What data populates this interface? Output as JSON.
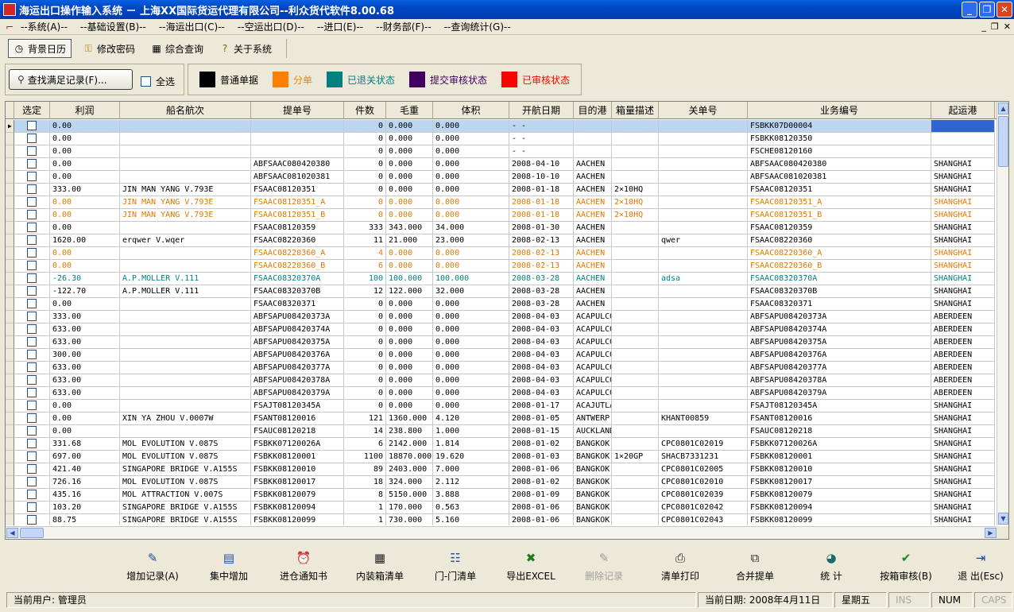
{
  "window": {
    "title": "海运出口操作输入系统 － 上海XX国际货运代理有限公司--利众货代软件8.00.68",
    "buttons": {
      "minimize": "_",
      "maximize": "❐",
      "close": "✕"
    }
  },
  "menu": {
    "items": [
      "--系统(A)--",
      "--基础设置(B)--",
      "--海运出口(C)--",
      "--空运出口(D)--",
      "--进口(E)--",
      "--财务部(F)--",
      "--查询统计(G)--"
    ],
    "mdi_buttons": [
      "_",
      "❐",
      "✕"
    ]
  },
  "toolbar": {
    "items": [
      {
        "label": "背景日历",
        "icon": "clock-icon"
      },
      {
        "label": "修改密码",
        "icon": "key-icon"
      },
      {
        "label": "综合查询",
        "icon": "grid-icon"
      },
      {
        "label": "关于系统",
        "icon": "help-icon"
      }
    ]
  },
  "filter": {
    "find_label": "查找满足记录(F)...",
    "select_all_label": "全选"
  },
  "legend": [
    {
      "label": "普通单据",
      "color": "#000000"
    },
    {
      "label": "分单",
      "color": "#ff8000"
    },
    {
      "label": "已退关状态",
      "color": "#008080"
    },
    {
      "label": "提交审核状态",
      "color": "#400060"
    },
    {
      "label": "已审核状态",
      "color": "#ff0000"
    }
  ],
  "grid": {
    "columns": [
      "选定",
      "利润",
      "船名航次",
      "提单号",
      "件数",
      "毛重",
      "体积",
      "开航日期",
      "目的港",
      "箱量描述",
      "关单号",
      "业务编号",
      "起运港"
    ],
    "colors": {
      "normal": "#000000",
      "split": "#e07800",
      "closed": "#008080"
    },
    "rows": [
      {
        "profit": "0.00",
        "vessel": "",
        "bl": "",
        "pcs": "0",
        "gw": "0.000",
        "vol": "0.000",
        "date": "-  -",
        "dest": "",
        "box": "",
        "customs": "",
        "biz": "FSBKK07D00004",
        "pol": "",
        "style": "normal",
        "selected": true
      },
      {
        "profit": "0.00",
        "vessel": "",
        "bl": "",
        "pcs": "0",
        "gw": "0.000",
        "vol": "0.000",
        "date": "-  -",
        "dest": "",
        "box": "",
        "customs": "",
        "biz": "FSBKK08120350",
        "pol": "",
        "style": "normal"
      },
      {
        "profit": "0.00",
        "vessel": "",
        "bl": "",
        "pcs": "0",
        "gw": "0.000",
        "vol": "0.000",
        "date": "-  -",
        "dest": "",
        "box": "",
        "customs": "",
        "biz": "FSCHE08120160",
        "pol": "",
        "style": "normal"
      },
      {
        "profit": "0.00",
        "vessel": "",
        "bl": "ABFSAAC080420380",
        "pcs": "0",
        "gw": "0.000",
        "vol": "0.000",
        "date": "2008-04-10",
        "dest": "AACHEN",
        "box": "",
        "customs": "",
        "biz": "ABFSAAC080420380",
        "pol": "SHANGHAI",
        "style": "normal"
      },
      {
        "profit": "0.00",
        "vessel": "",
        "bl": "ABFSAAC081020381",
        "pcs": "0",
        "gw": "0.000",
        "vol": "0.000",
        "date": "2008-10-10",
        "dest": "AACHEN",
        "box": "",
        "customs": "",
        "biz": "ABFSAAC081020381",
        "pol": "SHANGHAI",
        "style": "normal"
      },
      {
        "profit": "333.00",
        "vessel": "JIN MAN YANG V.793E",
        "bl": "FSAAC08120351",
        "pcs": "0",
        "gw": "0.000",
        "vol": "0.000",
        "date": "2008-01-18",
        "dest": "AACHEN",
        "box": "2×10HQ",
        "customs": "",
        "biz": "FSAAC08120351",
        "pol": "SHANGHAI",
        "style": "normal"
      },
      {
        "profit": "0.00",
        "vessel": "JIN MAN YANG V.793E",
        "bl": "FSAAC08120351_A",
        "pcs": "0",
        "gw": "0.000",
        "vol": "0.000",
        "date": "2008-01-18",
        "dest": "AACHEN",
        "box": "2×10HQ",
        "customs": "",
        "biz": "FSAAC08120351_A",
        "pol": "SHANGHAI",
        "style": "split"
      },
      {
        "profit": "0.00",
        "vessel": "JIN MAN YANG V.793E",
        "bl": "FSAAC08120351_B",
        "pcs": "0",
        "gw": "0.000",
        "vol": "0.000",
        "date": "2008-01-18",
        "dest": "AACHEN",
        "box": "2×10HQ",
        "customs": "",
        "biz": "FSAAC08120351_B",
        "pol": "SHANGHAI",
        "style": "split"
      },
      {
        "profit": "0.00",
        "vessel": "",
        "bl": "FSAAC08120359",
        "pcs": "333",
        "gw": "343.000",
        "vol": "34.000",
        "date": "2008-01-30",
        "dest": "AACHEN",
        "box": "",
        "customs": "",
        "biz": "FSAAC08120359",
        "pol": "SHANGHAI",
        "style": "normal"
      },
      {
        "profit": "1620.00",
        "vessel": "erqwer V.wqer",
        "bl": "FSAAC08220360",
        "pcs": "11",
        "gw": "21.000",
        "vol": "23.000",
        "date": "2008-02-13",
        "dest": "AACHEN",
        "box": "",
        "customs": "qwer",
        "biz": "FSAAC08220360",
        "pol": "SHANGHAI",
        "style": "normal"
      },
      {
        "profit": "0.00",
        "vessel": "",
        "bl": "FSAAC08220360_A",
        "pcs": "4",
        "gw": "0.000",
        "vol": "0.000",
        "date": "2008-02-13",
        "dest": "AACHEN",
        "box": "",
        "customs": "",
        "biz": "FSAAC08220360_A",
        "pol": "SHANGHAI",
        "style": "split"
      },
      {
        "profit": "0.00",
        "vessel": "",
        "bl": "FSAAC08220360_B",
        "pcs": "6",
        "gw": "0.000",
        "vol": "0.000",
        "date": "2008-02-13",
        "dest": "AACHEN",
        "box": "",
        "customs": "",
        "biz": "FSAAC08220360_B",
        "pol": "SHANGHAI",
        "style": "split"
      },
      {
        "profit": "-26.30",
        "vessel": "A.P.MOLLER V.111",
        "bl": "FSAAC08320370A",
        "pcs": "100",
        "gw": "100.000",
        "vol": "100.000",
        "date": "2008-03-28",
        "dest": "AACHEN",
        "box": "",
        "customs": "adsa",
        "biz": "FSAAC08320370A",
        "pol": "SHANGHAI",
        "style": "closed"
      },
      {
        "profit": "-122.70",
        "vessel": "A.P.MOLLER V.111",
        "bl": "FSAAC08320370B",
        "pcs": "12",
        "gw": "122.000",
        "vol": "32.000",
        "date": "2008-03-28",
        "dest": "AACHEN",
        "box": "",
        "customs": "",
        "biz": "FSAAC08320370B",
        "pol": "SHANGHAI",
        "style": "normal"
      },
      {
        "profit": "0.00",
        "vessel": "",
        "bl": "FSAAC08320371",
        "pcs": "0",
        "gw": "0.000",
        "vol": "0.000",
        "date": "2008-03-28",
        "dest": "AACHEN",
        "box": "",
        "customs": "",
        "biz": "FSAAC08320371",
        "pol": "SHANGHAI",
        "style": "normal"
      },
      {
        "profit": "333.00",
        "vessel": "",
        "bl": "ABFSAPU08420373A",
        "pcs": "0",
        "gw": "0.000",
        "vol": "0.000",
        "date": "2008-04-03",
        "dest": "ACAPULCO",
        "box": "",
        "customs": "",
        "biz": "ABFSAPU08420373A",
        "pol": "ABERDEEN",
        "style": "normal"
      },
      {
        "profit": "633.00",
        "vessel": "",
        "bl": "ABFSAPU08420374A",
        "pcs": "0",
        "gw": "0.000",
        "vol": "0.000",
        "date": "2008-04-03",
        "dest": "ACAPULCO",
        "box": "",
        "customs": "",
        "biz": "ABFSAPU08420374A",
        "pol": "ABERDEEN",
        "style": "normal"
      },
      {
        "profit": "633.00",
        "vessel": "",
        "bl": "ABFSAPU08420375A",
        "pcs": "0",
        "gw": "0.000",
        "vol": "0.000",
        "date": "2008-04-03",
        "dest": "ACAPULCO",
        "box": "",
        "customs": "",
        "biz": "ABFSAPU08420375A",
        "pol": "ABERDEEN",
        "style": "normal"
      },
      {
        "profit": "300.00",
        "vessel": "",
        "bl": "ABFSAPU08420376A",
        "pcs": "0",
        "gw": "0.000",
        "vol": "0.000",
        "date": "2008-04-03",
        "dest": "ACAPULCO",
        "box": "",
        "customs": "",
        "biz": "ABFSAPU08420376A",
        "pol": "ABERDEEN",
        "style": "normal"
      },
      {
        "profit": "633.00",
        "vessel": "",
        "bl": "ABFSAPU08420377A",
        "pcs": "0",
        "gw": "0.000",
        "vol": "0.000",
        "date": "2008-04-03",
        "dest": "ACAPULCO",
        "box": "",
        "customs": "",
        "biz": "ABFSAPU08420377A",
        "pol": "ABERDEEN",
        "style": "normal"
      },
      {
        "profit": "633.00",
        "vessel": "",
        "bl": "ABFSAPU08420378A",
        "pcs": "0",
        "gw": "0.000",
        "vol": "0.000",
        "date": "2008-04-03",
        "dest": "ACAPULCO",
        "box": "",
        "customs": "",
        "biz": "ABFSAPU08420378A",
        "pol": "ABERDEEN",
        "style": "normal"
      },
      {
        "profit": "633.00",
        "vessel": "",
        "bl": "ABFSAPU08420379A",
        "pcs": "0",
        "gw": "0.000",
        "vol": "0.000",
        "date": "2008-04-03",
        "dest": "ACAPULCO",
        "box": "",
        "customs": "",
        "biz": "ABFSAPU08420379A",
        "pol": "ABERDEEN",
        "style": "normal"
      },
      {
        "profit": "0.00",
        "vessel": "",
        "bl": "FSAJT08120345A",
        "pcs": "0",
        "gw": "0.000",
        "vol": "0.000",
        "date": "2008-01-17",
        "dest": "ACAJUTLA",
        "box": "",
        "customs": "",
        "biz": "FSAJT08120345A",
        "pol": "SHANGHAI",
        "style": "normal"
      },
      {
        "profit": "0.00",
        "vessel": "XIN YA ZHOU V.0007W",
        "bl": "FSANT08120016",
        "pcs": "121",
        "gw": "1360.000",
        "vol": "4.120",
        "date": "2008-01-05",
        "dest": "ANTWERP",
        "box": "",
        "customs": "KHANT00859",
        "biz": "FSANT08120016",
        "pol": "SHANGHAI",
        "style": "normal"
      },
      {
        "profit": "0.00",
        "vessel": "",
        "bl": "FSAUC08120218",
        "pcs": "14",
        "gw": "238.800",
        "vol": "1.000",
        "date": "2008-01-15",
        "dest": "AUCKLAND",
        "box": "",
        "customs": "",
        "biz": "FSAUC08120218",
        "pol": "SHANGHAI",
        "style": "normal"
      },
      {
        "profit": "331.68",
        "vessel": "MOL EVOLUTION V.087S",
        "bl": "FSBKK07120026A",
        "pcs": "6",
        "gw": "2142.000",
        "vol": "1.814",
        "date": "2008-01-02",
        "dest": "BANGKOK",
        "box": "",
        "customs": "CPC0801C02019",
        "biz": "FSBKK07120026A",
        "pol": "SHANGHAI",
        "style": "normal"
      },
      {
        "profit": "697.00",
        "vessel": "MOL EVOLUTION V.087S",
        "bl": "FSBKK08120001",
        "pcs": "1100",
        "gw": "18870.000",
        "vol": "19.620",
        "date": "2008-01-03",
        "dest": "BANGKOK",
        "box": "1×20GP",
        "customs": "SHACB7331231",
        "biz": "FSBKK08120001",
        "pol": "SHANGHAI",
        "style": "normal"
      },
      {
        "profit": "421.40",
        "vessel": "SINGAPORE BRIDGE V.A155S",
        "bl": "FSBKK08120010",
        "pcs": "89",
        "gw": "2403.000",
        "vol": "7.000",
        "date": "2008-01-06",
        "dest": "BANGKOK",
        "box": "",
        "customs": "CPC0801C02005",
        "biz": "FSBKK08120010",
        "pol": "SHANGHAI",
        "style": "normal"
      },
      {
        "profit": "726.16",
        "vessel": "MOL EVOLUTION V.087S",
        "bl": "FSBKK08120017",
        "pcs": "18",
        "gw": "324.000",
        "vol": "2.112",
        "date": "2008-01-02",
        "dest": "BANGKOK",
        "box": "",
        "customs": "CPC0801C02010",
        "biz": "FSBKK08120017",
        "pol": "SHANGHAI",
        "style": "normal"
      },
      {
        "profit": "435.16",
        "vessel": "MOL ATTRACTION V.007S",
        "bl": "FSBKK08120079",
        "pcs": "8",
        "gw": "5150.000",
        "vol": "3.888",
        "date": "2008-01-09",
        "dest": "BANGKOK",
        "box": "",
        "customs": "CPC0801C02039",
        "biz": "FSBKK08120079",
        "pol": "SHANGHAI",
        "style": "normal"
      },
      {
        "profit": "103.20",
        "vessel": "SINGAPORE BRIDGE V.A155S",
        "bl": "FSBKK08120094",
        "pcs": "1",
        "gw": "170.000",
        "vol": "0.563",
        "date": "2008-01-06",
        "dest": "BANGKOK",
        "box": "",
        "customs": "CPC0801C02042",
        "biz": "FSBKK08120094",
        "pol": "SHANGHAI",
        "style": "normal"
      },
      {
        "profit": "88.75",
        "vessel": "SINGAPORE BRIDGE V.A155S",
        "bl": "FSBKK08120099",
        "pcs": "1",
        "gw": "730.000",
        "vol": "5.160",
        "date": "2008-01-06",
        "dest": "BANGKOK",
        "box": "",
        "customs": "CPC0801C02043",
        "biz": "FSBKK08120099",
        "pol": "SHANGHAI",
        "style": "normal"
      }
    ]
  },
  "actions": [
    {
      "label": "增加记录(A)",
      "icon": "add-record-icon",
      "glyph": "✎",
      "enabled": true
    },
    {
      "label": "集中增加",
      "icon": "batch-add-icon",
      "glyph": "▤",
      "enabled": true
    },
    {
      "label": "进仓通知书",
      "icon": "alarm-clock-icon",
      "glyph": "⏰",
      "enabled": true
    },
    {
      "label": "内装箱清单",
      "icon": "table-icon",
      "glyph": "▦",
      "enabled": true
    },
    {
      "label": "门-门清单",
      "icon": "list-icon",
      "glyph": "☷",
      "enabled": true
    },
    {
      "label": "导出EXCEL",
      "icon": "excel-icon",
      "glyph": "✖",
      "enabled": true
    },
    {
      "label": "删除记录",
      "icon": "delete-record-icon",
      "glyph": "✎",
      "enabled": false
    },
    {
      "label": "清单打印",
      "icon": "printer-icon",
      "glyph": "⎙",
      "enabled": true
    },
    {
      "label": "合并提单",
      "icon": "merge-icon",
      "glyph": "⧉",
      "enabled": true
    },
    {
      "label": "统 计",
      "icon": "statistics-icon",
      "glyph": "◕",
      "enabled": true
    },
    {
      "label": "按箱审核(B)",
      "icon": "checkmark-icon",
      "glyph": "✔",
      "enabled": true
    },
    {
      "label": "退 出(Esc)",
      "icon": "exit-door-icon",
      "glyph": "⇥",
      "enabled": true
    }
  ],
  "status": {
    "user": "当前用户: 管理员",
    "date": "当前日期: 2008年4月11日",
    "weekday": "星期五",
    "ins": "INS",
    "num": "NUM",
    "caps": "CAPS"
  }
}
